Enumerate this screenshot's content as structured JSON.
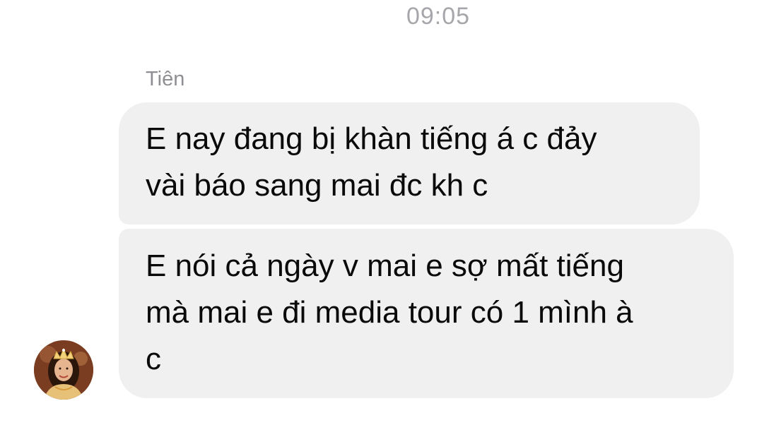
{
  "chat": {
    "timestamp": "09:05",
    "sender_name": "Tiên",
    "messages": [
      {
        "lines": [
          "E nay đang bị khàn tiếng á c đảy",
          "vài báo sang mai đc kh c"
        ]
      },
      {
        "lines": [
          "E nói cả ngày v mai e sợ mất tiếng",
          "mà mai e đi media tour có 1 mình à",
          "c"
        ]
      }
    ],
    "avatar_icon": "profile-photo-avatar"
  },
  "colors": {
    "bubble_background": "#f0f0f0",
    "timestamp_text": "#a7a7ab",
    "sender_text": "#8e8e93",
    "message_text": "#0a0a0a"
  }
}
